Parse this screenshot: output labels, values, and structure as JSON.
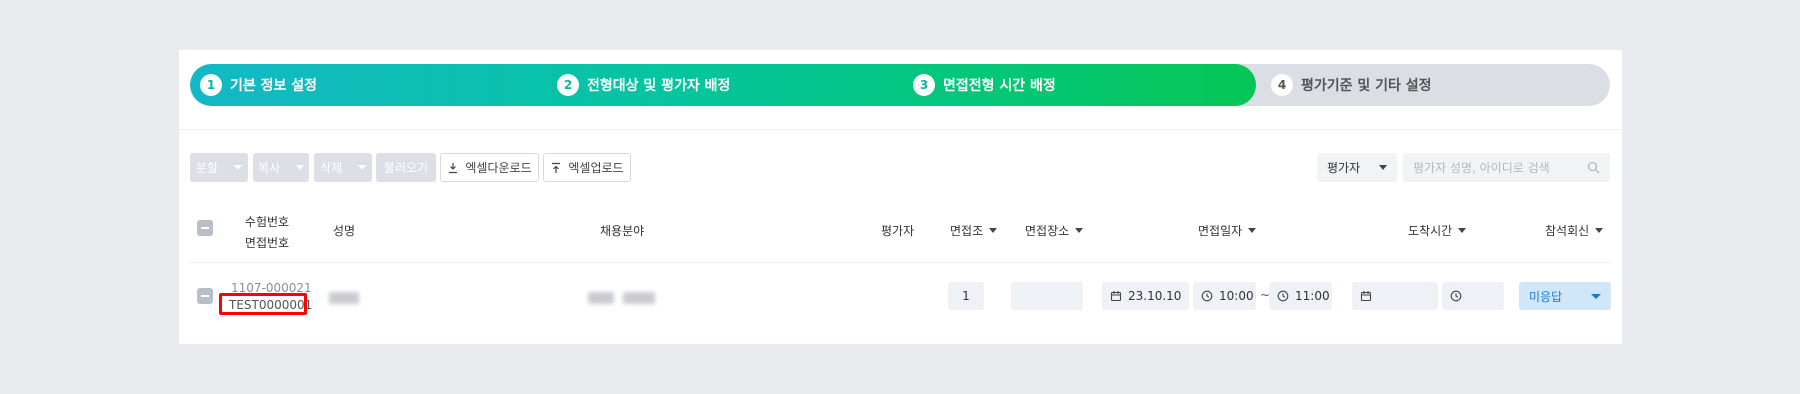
{
  "steps": [
    {
      "num": "1",
      "label": "기본 정보 설정"
    },
    {
      "num": "2",
      "label": "전형대상 및 평가자 배정"
    },
    {
      "num": "3",
      "label": "면접전형 시간 배정"
    },
    {
      "num": "4",
      "label": "평가기준 및 기타 설정"
    }
  ],
  "progress_completed_steps": 3,
  "colors": {
    "accent_teal": "#13b8c6",
    "accent_green": "#04c756",
    "highlight_red": "#ff0000",
    "response_blue": "#1d7acb"
  },
  "toolbar": {
    "split": "분할",
    "copy": "복사",
    "delete": "삭제",
    "import": "불러오기",
    "excel_download": "엑셀다운로드",
    "excel_upload": "엑셀업로드",
    "filter_select": "평가자",
    "search_placeholder": "평가자 성명, 아이디로 검색"
  },
  "table": {
    "headers": {
      "exam_number": "수험번호",
      "interview_number": "면접번호",
      "name": "성명",
      "field": "채용분야",
      "evaluator": "평가자",
      "group": "면접조",
      "place": "면접장소",
      "date": "면접일자",
      "arrival": "도착시간",
      "attendance": "참석회신"
    },
    "rows": [
      {
        "exam_number": "1107-000021",
        "interview_number": "TEST0000001",
        "group": "1",
        "date": "23.10.10",
        "start_time": "10:00",
        "tilde": "~",
        "end_time": "11:00",
        "attendance": "미응답"
      }
    ]
  },
  "icons": [
    "download-icon",
    "upload-icon",
    "search-icon",
    "calendar-icon",
    "clock-icon"
  ]
}
